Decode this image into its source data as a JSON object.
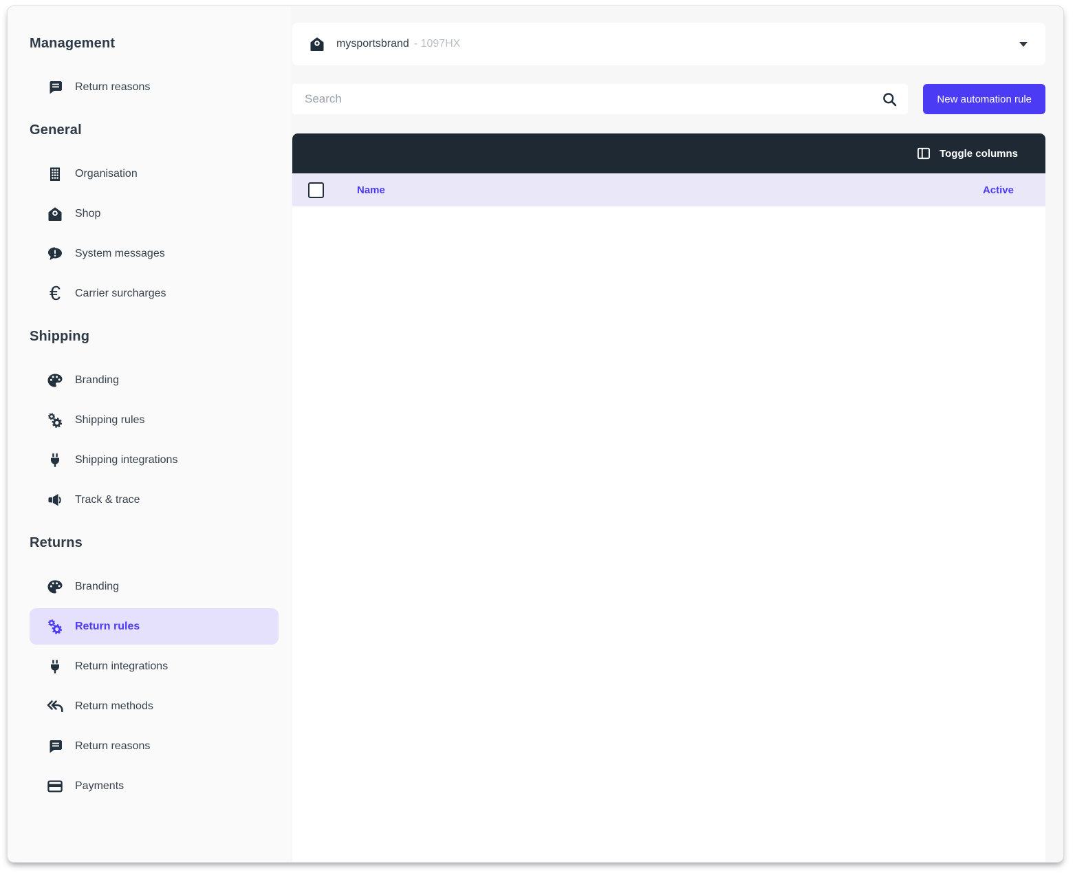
{
  "colors": {
    "accent": "#4b3bf5",
    "dark_bar": "#1f2933",
    "header_row_bg": "#eae7f9",
    "active_item_bg": "#e5e0fb",
    "sidebar_bg": "#fafafa",
    "main_bg": "#f7f7f8"
  },
  "sidebar": {
    "sections": [
      {
        "title": "Management",
        "items": [
          {
            "label": "Return reasons",
            "icon": "comment-lines-icon",
            "active": false
          }
        ]
      },
      {
        "title": "General",
        "items": [
          {
            "label": "Organisation",
            "icon": "building-icon",
            "active": false
          },
          {
            "label": "Shop",
            "icon": "shop-icon",
            "active": false
          },
          {
            "label": "System messages",
            "icon": "comment-exclamation-icon",
            "active": false
          },
          {
            "label": "Carrier surcharges",
            "icon": "euro-icon",
            "active": false
          }
        ]
      },
      {
        "title": "Shipping",
        "items": [
          {
            "label": "Branding",
            "icon": "palette-icon",
            "active": false
          },
          {
            "label": "Shipping rules",
            "icon": "gears-icon",
            "active": false
          },
          {
            "label": "Shipping integrations",
            "icon": "plug-icon",
            "active": false
          },
          {
            "label": "Track & trace",
            "icon": "megaphone-icon",
            "active": false
          }
        ]
      },
      {
        "title": "Returns",
        "items": [
          {
            "label": "Branding",
            "icon": "palette-icon",
            "active": false
          },
          {
            "label": "Return rules",
            "icon": "gears-icon",
            "active": true
          },
          {
            "label": "Return integrations",
            "icon": "plug-icon",
            "active": false
          },
          {
            "label": "Return methods",
            "icon": "reply-all-icon",
            "active": false
          },
          {
            "label": "Return reasons",
            "icon": "comment-lines-icon",
            "active": false
          },
          {
            "label": "Payments",
            "icon": "credit-card-icon",
            "active": false
          }
        ]
      }
    ]
  },
  "header": {
    "shop": {
      "icon": "shop-icon",
      "name": "mysportsbrand",
      "code_suffix": "- 1097HX"
    },
    "caret_icon": "caret-down-icon"
  },
  "toolbar": {
    "search": {
      "placeholder": "Search",
      "icon": "search-icon"
    },
    "primary_button": {
      "label": "New automation rule"
    }
  },
  "table": {
    "toolbar": {
      "toggle_columns": {
        "label": "Toggle columns",
        "icon": "columns-icon"
      }
    },
    "header": {
      "checkbox_checked": false,
      "name_label": "Name",
      "active_label": "Active"
    },
    "rows": []
  }
}
